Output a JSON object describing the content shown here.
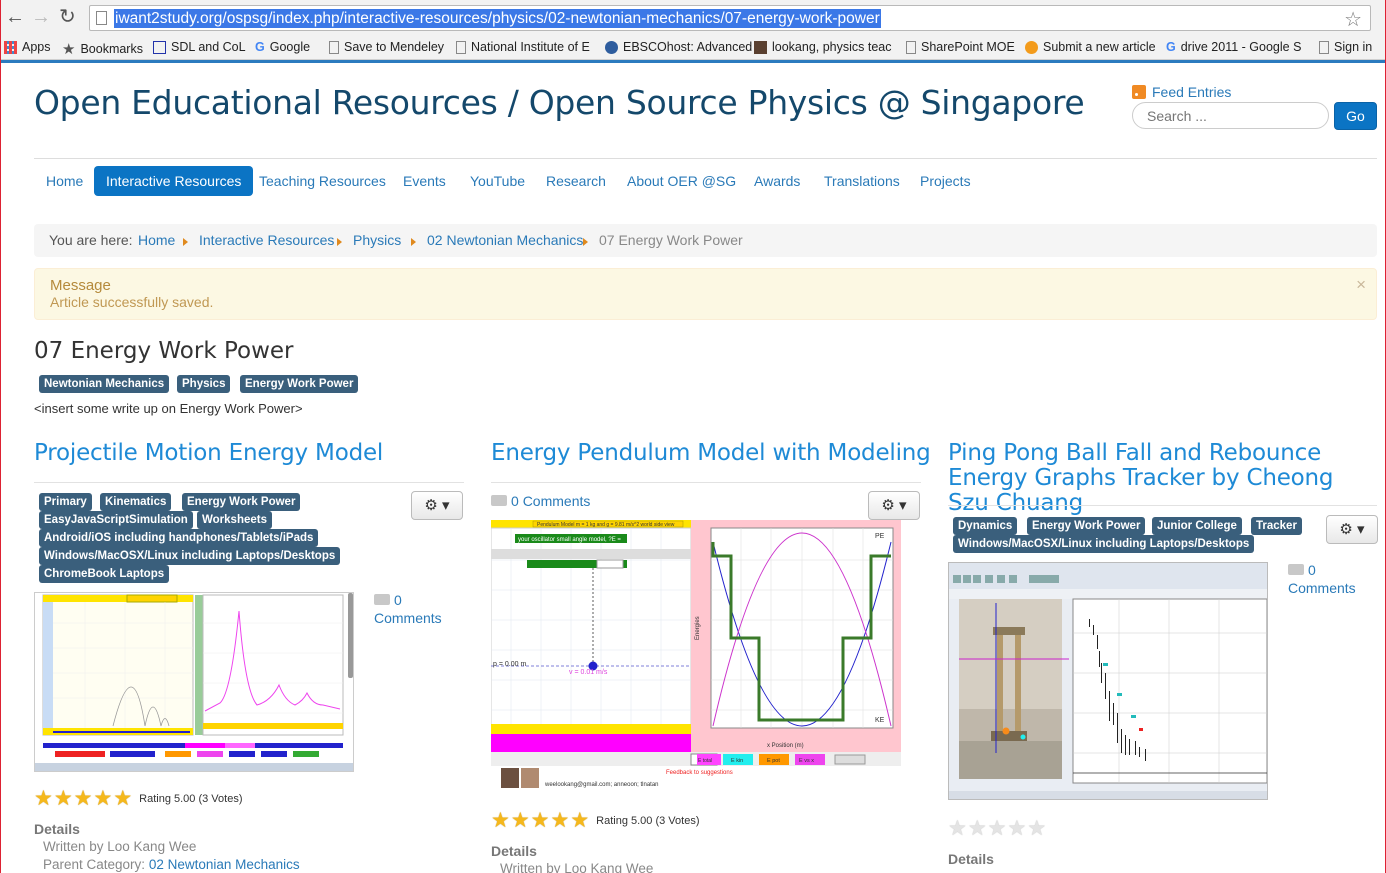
{
  "browser": {
    "url": "iwant2study.org/ospsg/index.php/interactive-resources/physics/02-newtonian-mechanics/07-energy-work-power",
    "bookmarks": [
      {
        "label": "Apps",
        "icon": "apps-grid-icon"
      },
      {
        "label": "Bookmarks",
        "icon": "star-icon"
      },
      {
        "label": "SDL and CoL",
        "icon": "page-icon"
      },
      {
        "label": "Google",
        "icon": "google-icon"
      },
      {
        "label": "Save to Mendeley",
        "icon": "page-icon"
      },
      {
        "label": "National Institute of E",
        "icon": "page-icon"
      },
      {
        "label": "EBSCOhost: Advanced",
        "icon": "ebsco-icon"
      },
      {
        "label": "lookang, physics teac",
        "icon": "avatar-icon"
      },
      {
        "label": "SharePoint MOE",
        "icon": "page-icon"
      },
      {
        "label": "Submit a new article",
        "icon": "joomla-icon"
      },
      {
        "label": "drive 2011 - Google S",
        "icon": "google-icon"
      },
      {
        "label": "Sign in",
        "icon": "page-icon"
      }
    ]
  },
  "site": {
    "title": "Open Educational Resources / Open Source Physics @ Singapore",
    "feed": "Feed Entries",
    "search_placeholder": "Search ...",
    "go": "Go"
  },
  "nav": [
    "Home",
    "Interactive Resources",
    "Teaching Resources",
    "Events",
    "YouTube",
    "Research",
    "About OER @SG",
    "Awards",
    "Translations",
    "Projects"
  ],
  "breadcrumb": {
    "prefix": "You are here:",
    "items": [
      "Home",
      "Interactive Resources",
      "Physics",
      "02 Newtonian Mechanics"
    ],
    "current": "07 Energy Work Power"
  },
  "alert": {
    "heading": "Message",
    "text": "Article successfully saved.",
    "close": "×"
  },
  "page": {
    "heading": "07 Energy Work Power",
    "tags": [
      "Newtonian Mechanics",
      "Physics",
      "Energy Work Power"
    ],
    "intro": "<insert some write up on Energy Work Power>"
  },
  "articles": [
    {
      "title": "Projectile Motion Energy Model",
      "tags": [
        "Primary",
        "Kinematics",
        "Energy Work Power",
        "EasyJavaScriptSimulation",
        "Worksheets",
        "Android/iOS including handphones/Tablets/iPads",
        "Windows/MacOSX/Linux including Laptops/Desktops",
        "ChromeBook Laptops"
      ],
      "comments_count": "0",
      "comments_label": "Comments",
      "rating": 5,
      "rating_text": "Rating 5.00 (3 Votes)",
      "details": "Details",
      "written_by": "Written by Loo Kang Wee",
      "parent_label": "Parent Category:",
      "parent_link": "02 Newtonian Mechanics"
    },
    {
      "title": "Energy Pendulum Model with Modeling",
      "comments_count": "0",
      "comments_label": "Comments",
      "rating": 5,
      "rating_text": "Rating 5.00 (3 Votes)",
      "details": "Details",
      "written_by": "Written by Loo Kang Wee",
      "thumb_text": {
        "top": "Pendulum Model m = 1 kg and g = 9.81 m/s^2 world side view",
        "model": "your oscillator small angle model, ?E =",
        "pos": "p = 0.00 m",
        "vel": "v = 0.01 m/s",
        "pe": "PE",
        "ke": "KE",
        "ylabel": "Energies",
        "xlabel": "x Position (m)",
        "footer": "weelookang@gmail.com; anneoon; tlnatan",
        "feedback": "Feedback to suggestions",
        "btn_et": "E total",
        "btn_ek": "E kin",
        "btn_ep": "E pot",
        "btn_vc": "E vs x"
      }
    },
    {
      "title": "Ping Pong Ball Fall and Rebounce Energy Graphs Tracker by Cheong Szu Chuang",
      "tags": [
        "Dynamics",
        "Energy Work Power",
        "Junior College",
        "Tracker",
        "Windows/MacOSX/Linux including Laptops/Desktops"
      ],
      "comments_count": "0",
      "comments_label": "Comments",
      "rating": 0,
      "details": "Details"
    }
  ],
  "colors": {
    "link": "#2a7ab8",
    "title": "#14486b",
    "article_title": "#1e8ad6",
    "tag_bg": "#3a5f7c",
    "nav_active": "#0b74c4",
    "star": "#f5b81c"
  }
}
